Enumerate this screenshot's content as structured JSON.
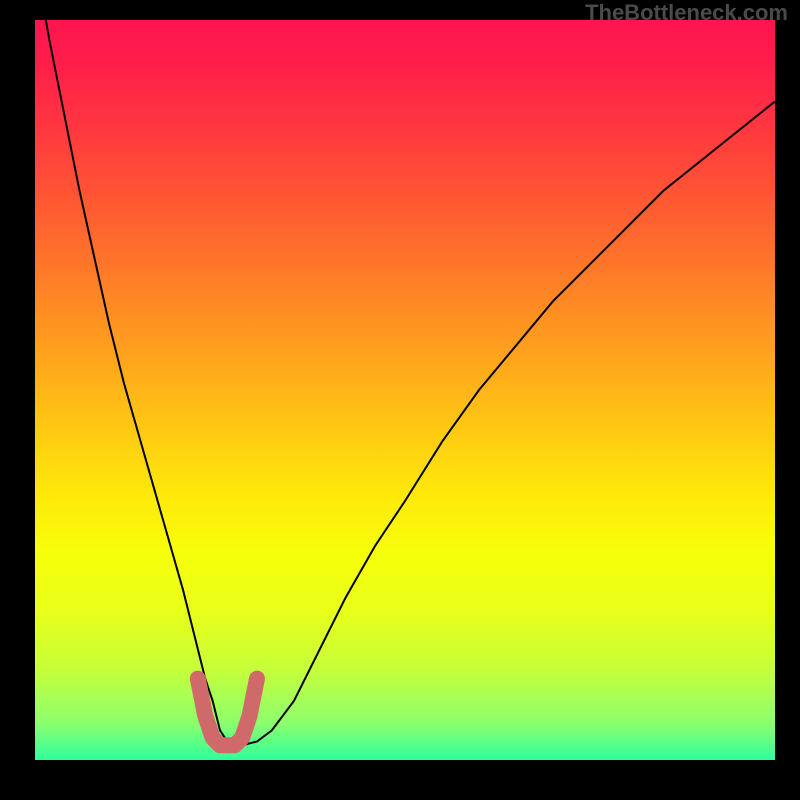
{
  "watermark": "TheBottleneck.com",
  "colors": {
    "gradient_top": "#ff1450",
    "gradient_mid": "#ffd400",
    "gradient_bottom": "#30ff9c",
    "curve": "#000000",
    "optimal_marker": "#d06a6a",
    "frame": "#000000"
  },
  "chart_data": {
    "type": "line",
    "title": "",
    "xlabel": "",
    "ylabel": "",
    "xlim": [
      0,
      100
    ],
    "ylim": [
      0,
      100
    ],
    "grid": false,
    "legend": false,
    "annotations": [
      "TheBottleneck.com"
    ],
    "series": [
      {
        "name": "bottleneck-curve",
        "color": "#000000",
        "x": [
          0,
          2,
          4,
          6,
          8,
          10,
          12,
          14,
          16,
          18,
          20,
          22,
          23,
          24,
          25,
          26,
          27,
          28,
          30,
          32,
          35,
          38,
          42,
          46,
          50,
          55,
          60,
          65,
          70,
          75,
          80,
          85,
          90,
          95,
          100
        ],
        "y": [
          108,
          97,
          87,
          77,
          68,
          59,
          51,
          44,
          37,
          30,
          23,
          15,
          11,
          8,
          4,
          2.5,
          2,
          2,
          2.5,
          4,
          8,
          14,
          22,
          29,
          35,
          43,
          50,
          56,
          62,
          67,
          72,
          77,
          81,
          85,
          89
        ]
      },
      {
        "name": "optimal-zone-marker",
        "color": "#d06a6a",
        "x": [
          22,
          23,
          24,
          25,
          26,
          27,
          28,
          29,
          30
        ],
        "y": [
          11,
          6,
          3,
          2,
          2,
          2,
          3,
          6,
          11
        ]
      }
    ]
  }
}
